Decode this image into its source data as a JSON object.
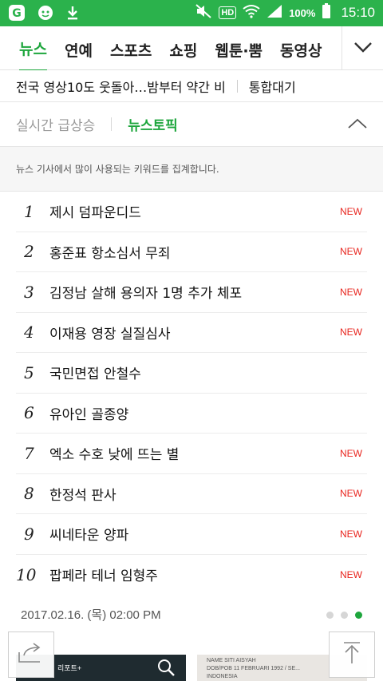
{
  "status_bar": {
    "battery_percent": "100%",
    "time": "15:10",
    "hd_label": "HD",
    "icons": [
      "naver-app-icon",
      "character-icon",
      "download-icon",
      "mute-icon",
      "hd-icon",
      "wifi-icon",
      "signal-icon",
      "battery-icon"
    ]
  },
  "nav": {
    "tabs": [
      {
        "label": "뉴스",
        "active": true
      },
      {
        "label": "연예",
        "active": false
      },
      {
        "label": "스포츠",
        "active": false
      },
      {
        "label": "쇼핑",
        "active": false
      },
      {
        "label": "웹툰·뿜",
        "active": false
      },
      {
        "label": "동영상",
        "active": false
      }
    ],
    "toggle_icon": "chevron-down-icon"
  },
  "ticker": {
    "headline": "전국 영상10도 웃돌아…밤부터 약간 비",
    "link": "통합대기"
  },
  "panel": {
    "tabs": [
      {
        "label": "실시간 급상승",
        "active": false
      },
      {
        "label": "뉴스토픽",
        "active": true
      }
    ],
    "collapse_icon": "chevron-up-icon",
    "description": "뉴스 기사에서 많이 사용되는 키워드를 집계합니다."
  },
  "keywords": [
    {
      "rank": "1",
      "text": "제시 덤파운디드",
      "badge": "NEW"
    },
    {
      "rank": "2",
      "text": "홍준표 항소심서 무죄",
      "badge": "NEW"
    },
    {
      "rank": "3",
      "text": "김정남 살해 용의자 1명 추가 체포",
      "badge": "NEW"
    },
    {
      "rank": "4",
      "text": "이재용 영장 실질심사",
      "badge": "NEW"
    },
    {
      "rank": "5",
      "text": "국민면접 안철수",
      "badge": ""
    },
    {
      "rank": "6",
      "text": "유아인 골종양",
      "badge": ""
    },
    {
      "rank": "7",
      "text": "엑소 수호 낮에 뜨는 별",
      "badge": "NEW"
    },
    {
      "rank": "8",
      "text": "한정석 판사",
      "badge": "NEW"
    },
    {
      "rank": "9",
      "text": "씨네타운 양파",
      "badge": "NEW"
    },
    {
      "rank": "10",
      "text": "팝페라 테너 임형주",
      "badge": "NEW"
    }
  ],
  "footer": {
    "timestamp": "2017.02.16. (목) 02:00 PM",
    "page_dots": {
      "count": 3,
      "active_index": 2
    }
  },
  "thumbnails": {
    "left_label": "리포트+",
    "right_lines": [
      "NAME          SITI AISYAH",
      "DOB/POB    11 FEBRUARI 1992 / SE...",
      "                  INDONESIA"
    ]
  },
  "float_buttons": {
    "left_icon": "share-icon",
    "right_icon": "scroll-to-top-icon"
  },
  "colors": {
    "accent_green": "#1ea63d",
    "status_bar_green": "#2bb24c",
    "new_badge_red": "#e8231c"
  }
}
